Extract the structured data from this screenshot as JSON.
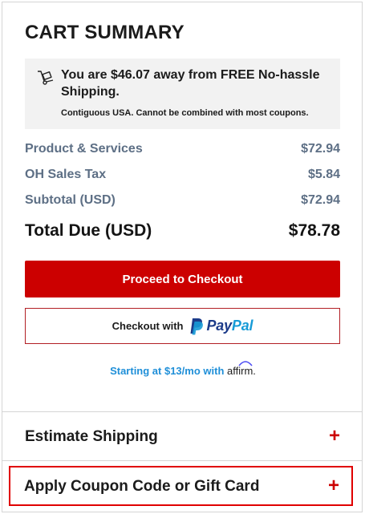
{
  "cart": {
    "title": "CART SUMMARY",
    "notice": {
      "headline": "You are $46.07 away from FREE No-hassle Shipping.",
      "fineprint": "Contiguous USA. Cannot be combined with most coupons."
    },
    "lines": [
      {
        "label": "Product & Services",
        "value": "$72.94"
      },
      {
        "label": "OH Sales Tax",
        "value": "$5.84"
      },
      {
        "label": "Subtotal (USD)",
        "value": "$72.94"
      }
    ],
    "total": {
      "label": "Total Due (USD)",
      "value": "$78.78"
    },
    "checkout_label": "Proceed to Checkout",
    "paypal": {
      "prefix": "Checkout with",
      "brand_pay": "Pay",
      "brand_pal": "Pal"
    },
    "affirm": {
      "text": "Starting at $13/mo with",
      "brand": "affirm."
    }
  },
  "accordions": [
    {
      "label": "Estimate Shipping",
      "icon": "+"
    },
    {
      "label": "Apply Coupon Code or Gift Card",
      "icon": "+"
    }
  ],
  "colors": {
    "accent": "#cc0000",
    "paypal_blue": "#1c3b89",
    "paypal_light": "#179bd7",
    "affirm_blue": "#1f8fd8",
    "muted_text": "#5d6f85"
  },
  "icons": {
    "shipping": "hand-truck-icon"
  }
}
